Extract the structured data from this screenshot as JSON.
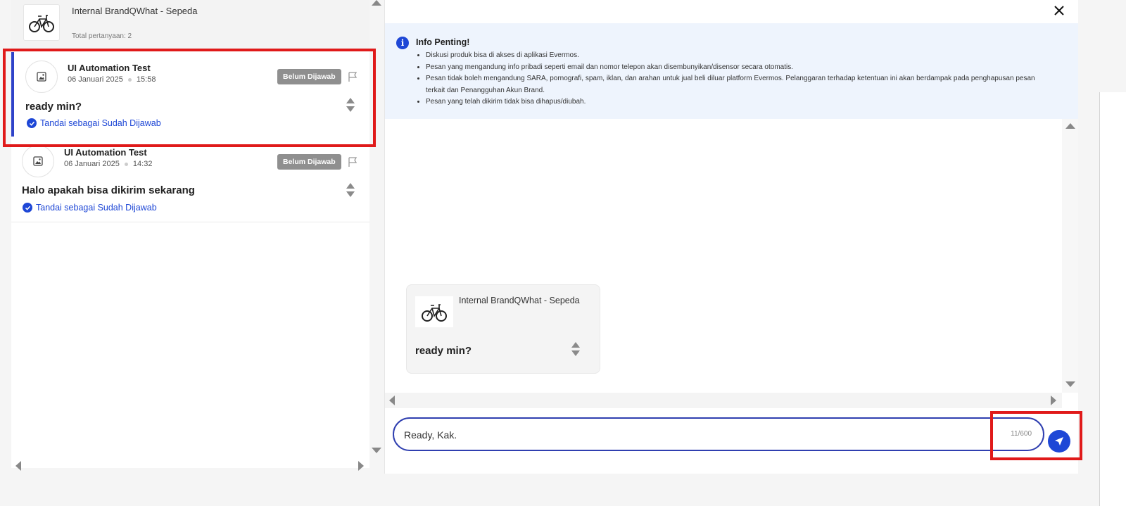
{
  "product": {
    "name": "Internal BrandQWhat - Sepeda",
    "total_questions": "Total pertanyaan: 2"
  },
  "questions": [
    {
      "user": "UI Automation Test",
      "date": "06 Januari 2025",
      "time": "15:58",
      "status": "Belum Dijawab",
      "text": "ready min?",
      "mark_action": "Tandai sebagai Sudah Dijawab",
      "selected": true
    },
    {
      "user": "UI Automation Test",
      "date": "06 Januari 2025",
      "time": "14:32",
      "status": "Belum Dijawab",
      "text": "Halo apakah bisa dikirim sekarang",
      "mark_action": "Tandai sebagai Sudah Dijawab",
      "selected": false
    }
  ],
  "info": {
    "title": "Info Penting!",
    "items": [
      "Diskusi produk bisa di akses di aplikasi Evermos.",
      "Pesan yang mengandung info pribadi seperti email dan nomor telepon akan disembunyikan/disensor secara otomatis.",
      "Pesan tidak boleh mengandung SARA, pornografi, spam, iklan, dan arahan untuk jual beli diluar platform Evermos. Pelanggaran terhadap ketentuan ini akan berdampak pada penghapusan pesan terkait dan Penangguhan Akun Brand.",
      "Pesan yang telah dikirim tidak bisa dihapus/diubah."
    ]
  },
  "chat": {
    "bubble_product": "Internal BrandQWhat - Sepeda",
    "bubble_text": "ready min?"
  },
  "reply": {
    "value": "Ready, Kak.",
    "char_count": "11/600"
  },
  "colors": {
    "accent": "#1e47d6",
    "highlight_box": "#e01a1a",
    "badge_bg": "#8f8f8f",
    "info_bg": "#eef4fd"
  },
  "icons": {
    "close": "close-icon",
    "send": "send-icon",
    "info": "info-icon",
    "flag": "flag-icon",
    "check": "check-circle-icon",
    "image_placeholder": "image-icon",
    "bicycle": "bicycle-icon"
  }
}
